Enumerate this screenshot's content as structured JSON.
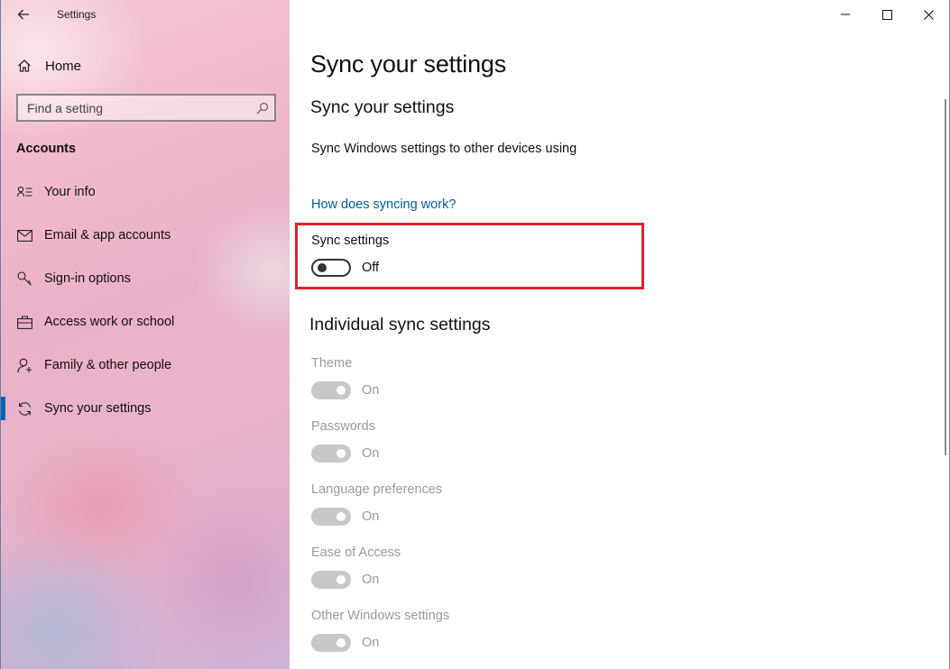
{
  "window": {
    "title": "Settings"
  },
  "sidebar": {
    "home_label": "Home",
    "search_placeholder": "Find a setting",
    "section_title": "Accounts",
    "items": [
      {
        "label": "Your info",
        "icon": "person-card-icon"
      },
      {
        "label": "Email & app accounts",
        "icon": "mail-icon"
      },
      {
        "label": "Sign-in options",
        "icon": "key-icon"
      },
      {
        "label": "Access work or school",
        "icon": "briefcase-icon"
      },
      {
        "label": "Family & other people",
        "icon": "person-add-icon"
      },
      {
        "label": "Sync your settings",
        "icon": "sync-icon",
        "active": true
      }
    ]
  },
  "main": {
    "page_title": "Sync your settings",
    "sub_title": "Sync your settings",
    "description": "Sync Windows settings to other devices using",
    "link": "How does syncing work?",
    "sync_settings": {
      "label": "Sync settings",
      "state": "Off"
    },
    "individual_title": "Individual sync settings",
    "individual": [
      {
        "label": "Theme",
        "state": "On"
      },
      {
        "label": "Passwords",
        "state": "On"
      },
      {
        "label": "Language preferences",
        "state": "On"
      },
      {
        "label": "Ease of Access",
        "state": "On"
      },
      {
        "label": "Other Windows settings",
        "state": "On"
      }
    ]
  },
  "colors": {
    "accent": "#0063b1",
    "link": "#005a9e",
    "highlight_border": "#e1232b",
    "disabled_text": "#9a9a9a"
  }
}
